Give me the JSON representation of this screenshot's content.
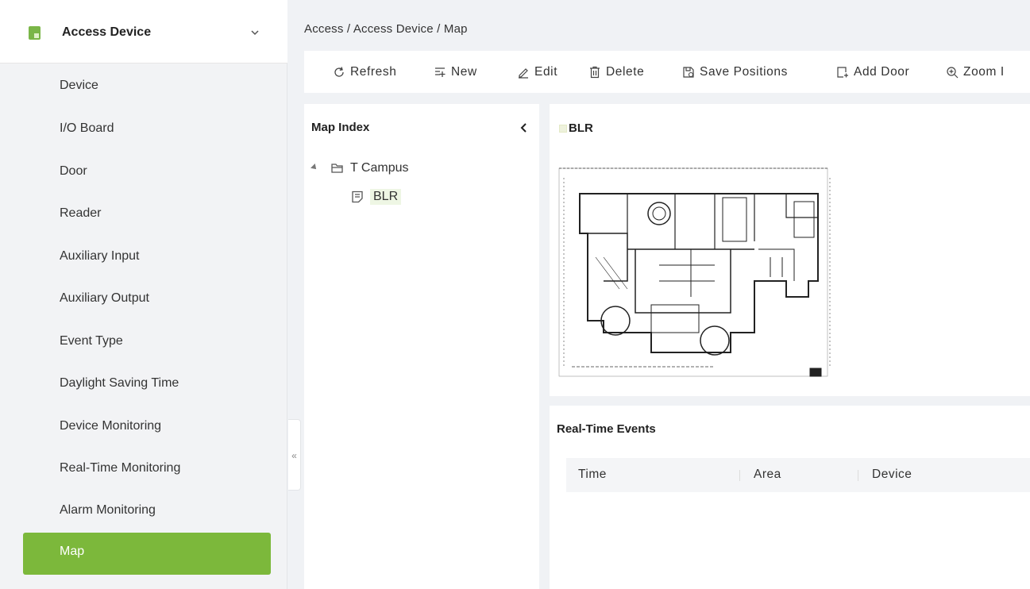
{
  "sidebar": {
    "title": "Access Device",
    "items": [
      {
        "label": "Device"
      },
      {
        "label": "I/O Board"
      },
      {
        "label": "Door"
      },
      {
        "label": "Reader"
      },
      {
        "label": "Auxiliary Input"
      },
      {
        "label": "Auxiliary Output"
      },
      {
        "label": "Event Type"
      },
      {
        "label": "Daylight Saving Time"
      },
      {
        "label": "Device Monitoring"
      },
      {
        "label": "Real-Time Monitoring"
      },
      {
        "label": "Alarm Monitoring"
      }
    ],
    "active_item": "Map",
    "collapse_glyph": "«",
    "accent_color": "#7cb83b"
  },
  "breadcrumb": "Access / Access Device / Map",
  "toolbar": {
    "refresh": "Refresh",
    "new": "New",
    "edit": "Edit",
    "delete": "Delete",
    "save_positions": "Save Positions",
    "add_door": "Add Door",
    "zoom": "Zoom I"
  },
  "map_index": {
    "title": "Map Index",
    "tree": {
      "root": "T Campus",
      "child": "BLR"
    }
  },
  "map_panel": {
    "title": "BLR"
  },
  "events": {
    "title": "Real-Time Events",
    "columns": [
      "Time",
      "Area",
      "Device"
    ]
  }
}
